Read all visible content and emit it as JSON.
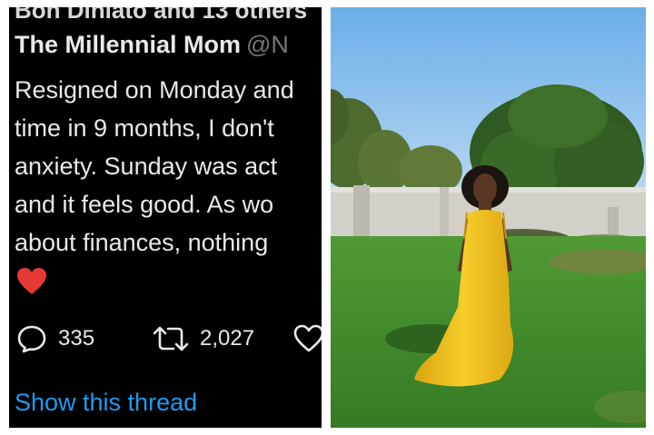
{
  "tweet": {
    "cutoff_text": "Bon Dlhlato and 13 others",
    "author_name": "The Millennial Mom",
    "author_handle": "@N",
    "body_lines": [
      "Resigned on Monday and",
      "time in 9 months, I don't",
      "anxiety. Sunday was act",
      "and it feels good. As wo",
      "about finances, nothing"
    ],
    "emoji": "heart-emoji",
    "replies": "335",
    "retweets": "2,027",
    "show_thread": "Show this thread"
  },
  "colors": {
    "tweet_background": "#000000",
    "text": "#e7e9ea",
    "handle": "#71767b",
    "link": "#1d9bf0",
    "heart": "#f91880",
    "dress": "#f2c21b",
    "sky": "#79b6ea",
    "grass": "#3f8a2b"
  },
  "icons": {
    "reply": "reply-icon",
    "retweet": "retweet-icon",
    "like": "like-icon"
  }
}
